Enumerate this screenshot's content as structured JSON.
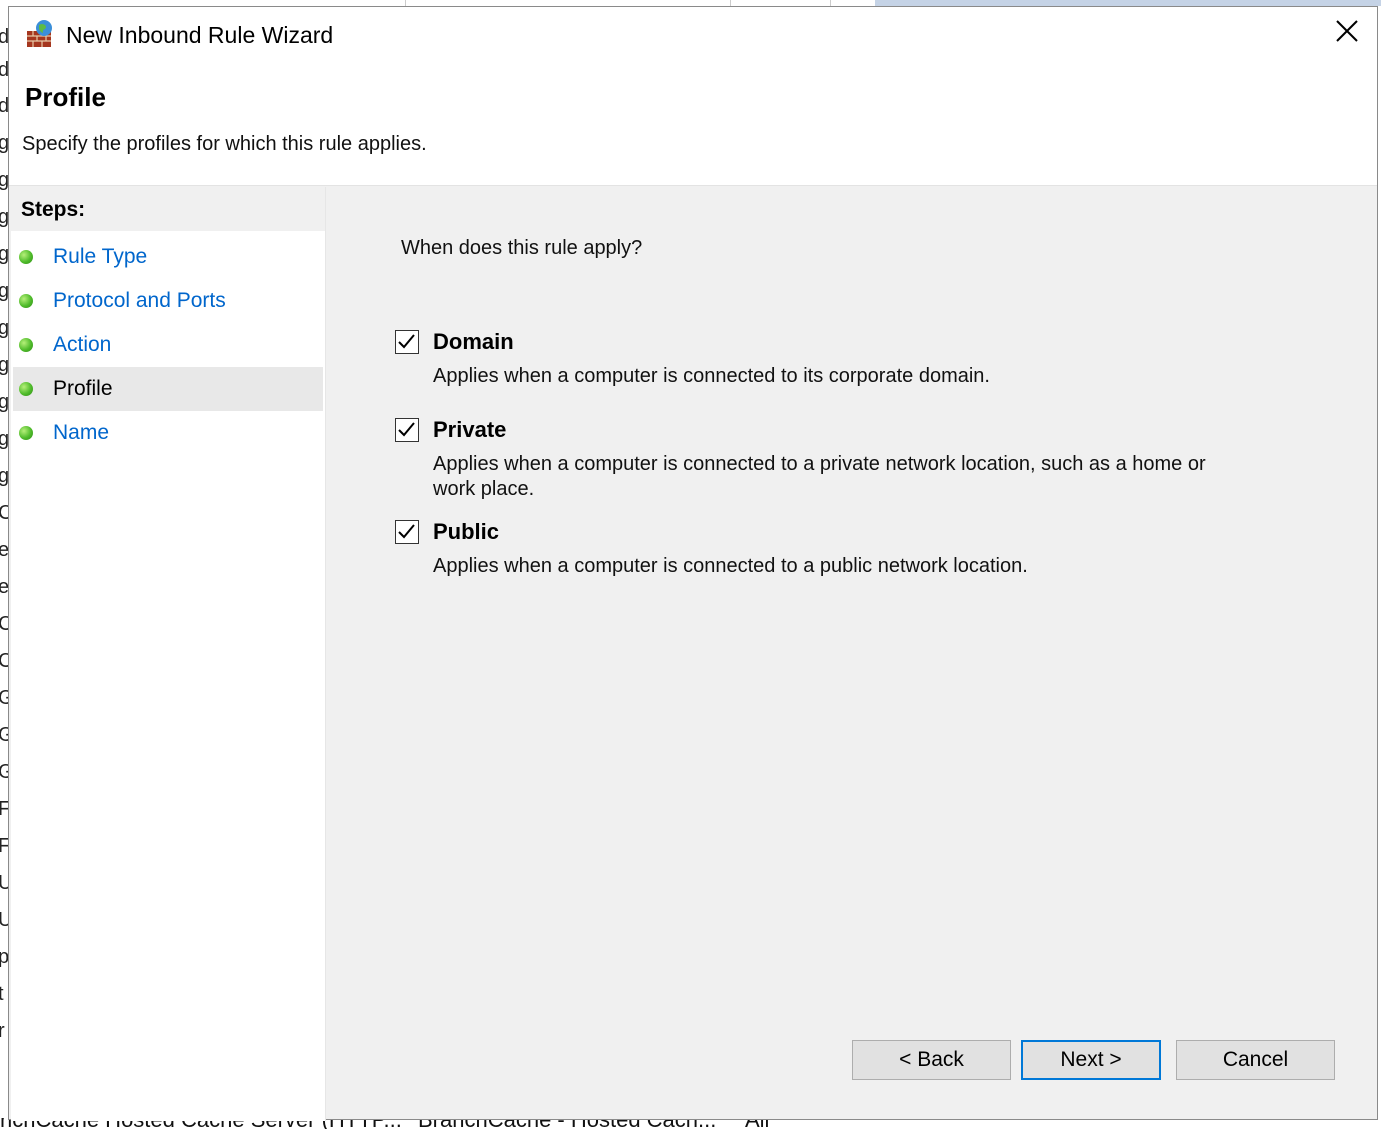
{
  "background": {
    "left_chars": [
      "d",
      "d",
      "d",
      "g",
      "g",
      "g",
      "g",
      "g",
      "g",
      "g",
      "g",
      "g",
      "g",
      "C",
      "e",
      "e",
      "C",
      "C",
      "G",
      "G",
      "G",
      "F",
      "F",
      "U",
      "U",
      "p",
      "t",
      "r"
    ],
    "bottom_text": [
      "nchCache Hosted Cache Server (HTTP...",
      "BranchCache - Hosted Cach...",
      "All"
    ]
  },
  "window": {
    "title": "New Inbound Rule Wizard",
    "icon": "firewall-globe-icon",
    "close_icon": "close-icon"
  },
  "header": {
    "title": "Profile",
    "subtitle": "Specify the profiles for which this rule applies."
  },
  "steps": {
    "heading": "Steps:",
    "items": [
      {
        "label": "Rule Type",
        "active": false
      },
      {
        "label": "Protocol and Ports",
        "active": false
      },
      {
        "label": "Action",
        "active": false
      },
      {
        "label": "Profile",
        "active": true
      },
      {
        "label": "Name",
        "active": false
      }
    ]
  },
  "main": {
    "question": "When does this rule apply?",
    "options": [
      {
        "title": "Domain",
        "checked": true,
        "description": "Applies when a computer is connected to its corporate domain."
      },
      {
        "title": "Private",
        "checked": true,
        "description": "Applies when a computer is connected to a private network location, such as a home or work place."
      },
      {
        "title": "Public",
        "checked": true,
        "description": "Applies when a computer is connected to a public network location."
      }
    ]
  },
  "buttons": {
    "back": "< Back",
    "next": "Next >",
    "cancel": "Cancel"
  },
  "colors": {
    "link": "#0066cc",
    "dialog_bg": "#f0f0f0",
    "default_button_border": "#0078d7"
  }
}
